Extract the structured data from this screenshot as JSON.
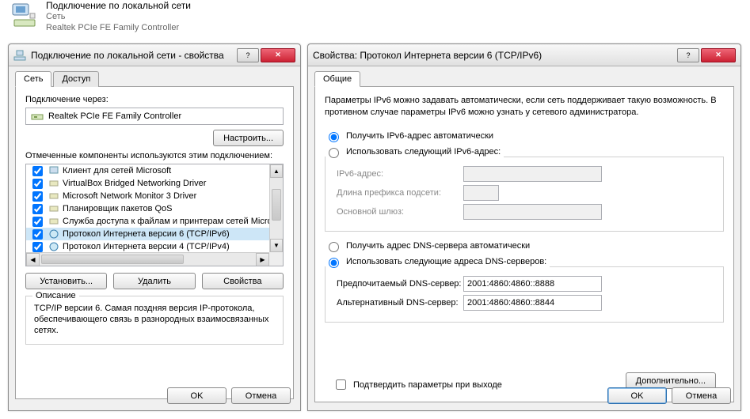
{
  "banner": {
    "title": "Подключение по локальной сети",
    "sub1": "Сеть",
    "sub2": "Realtek PCIe FE Family Controller"
  },
  "left": {
    "title": "Подключение по локальной сети - свойства",
    "tabs": {
      "network": "Сеть",
      "access": "Доступ"
    },
    "connect_via_label": "Подключение через:",
    "adapter": "Realtek PCIe FE Family Controller",
    "configure_btn": "Настроить...",
    "components_label": "Отмеченные компоненты используются этим подключением:",
    "components": [
      "Клиент для сетей Microsoft",
      "VirtualBox Bridged Networking Driver",
      "Microsoft Network Monitor 3 Driver",
      "Планировщик пакетов QoS",
      "Служба доступа к файлам и принтерам сетей Micro",
      "Протокол Интернета версии 6 (TCP/IPv6)",
      "Протокол Интернета версии 4 (TCP/IPv4)"
    ],
    "install_btn": "Установить...",
    "uninstall_btn": "Удалить",
    "properties_btn": "Свойства",
    "desc_title": "Описание",
    "desc_text": "TCP/IP версии 6. Самая поздняя версия IP-протокола, обеспечивающего связь в разнородных взаимосвязанных сетях.",
    "ok": "OK",
    "cancel": "Отмена"
  },
  "right": {
    "title": "Свойства: Протокол Интернета версии 6 (TCP/IPv6)",
    "tab_general": "Общие",
    "info": "Параметры IPv6 можно задавать автоматически, если сеть поддерживает такую возможность. В противном случае параметры IPv6 можно узнать у сетевого администратора.",
    "ip_auto": "Получить IPv6-адрес автоматически",
    "ip_manual": "Использовать следующий IPv6-адрес:",
    "ip_addr_label": "IPv6-адрес:",
    "prefix_label": "Длина префикса подсети:",
    "gateway_label": "Основной шлюз:",
    "dns_auto": "Получить адрес DNS-сервера автоматически",
    "dns_manual": "Использовать следующие адреса DNS-серверов:",
    "dns_pref_label": "Предпочитаемый DNS-сервер:",
    "dns_pref_value": "2001:4860:4860::8888",
    "dns_alt_label": "Альтернативный DNS-сервер:",
    "dns_alt_value": "2001:4860:4860::8844",
    "validate_label": "Подтвердить параметры при выходе",
    "advanced_btn": "Дополнительно...",
    "ok": "OK",
    "cancel": "Отмена"
  }
}
